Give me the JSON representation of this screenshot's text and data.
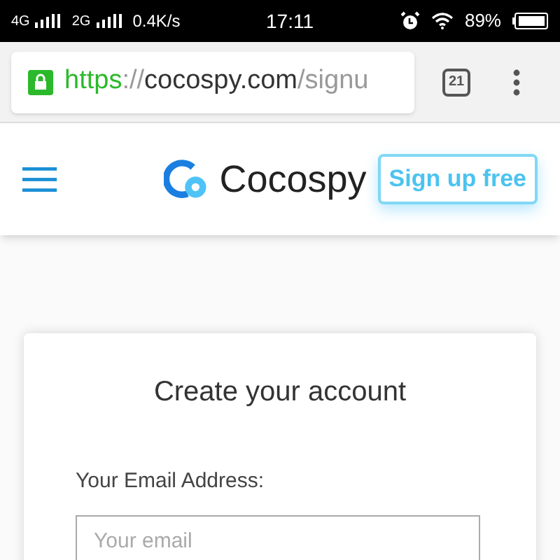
{
  "status_bar": {
    "network_1": "4G",
    "network_2": "2G",
    "speed": "0.4K/s",
    "time": "17:11",
    "battery": "89%"
  },
  "browser": {
    "url": {
      "scheme": "https",
      "separator": "://",
      "host": "cocospy.com",
      "path": "/signu"
    },
    "tab_count": "21"
  },
  "header": {
    "brand": "Cocospy",
    "signup_button": "Sign up free"
  },
  "card": {
    "title": "Create your account",
    "email_label": "Your Email Address:",
    "email_placeholder": "Your email"
  }
}
